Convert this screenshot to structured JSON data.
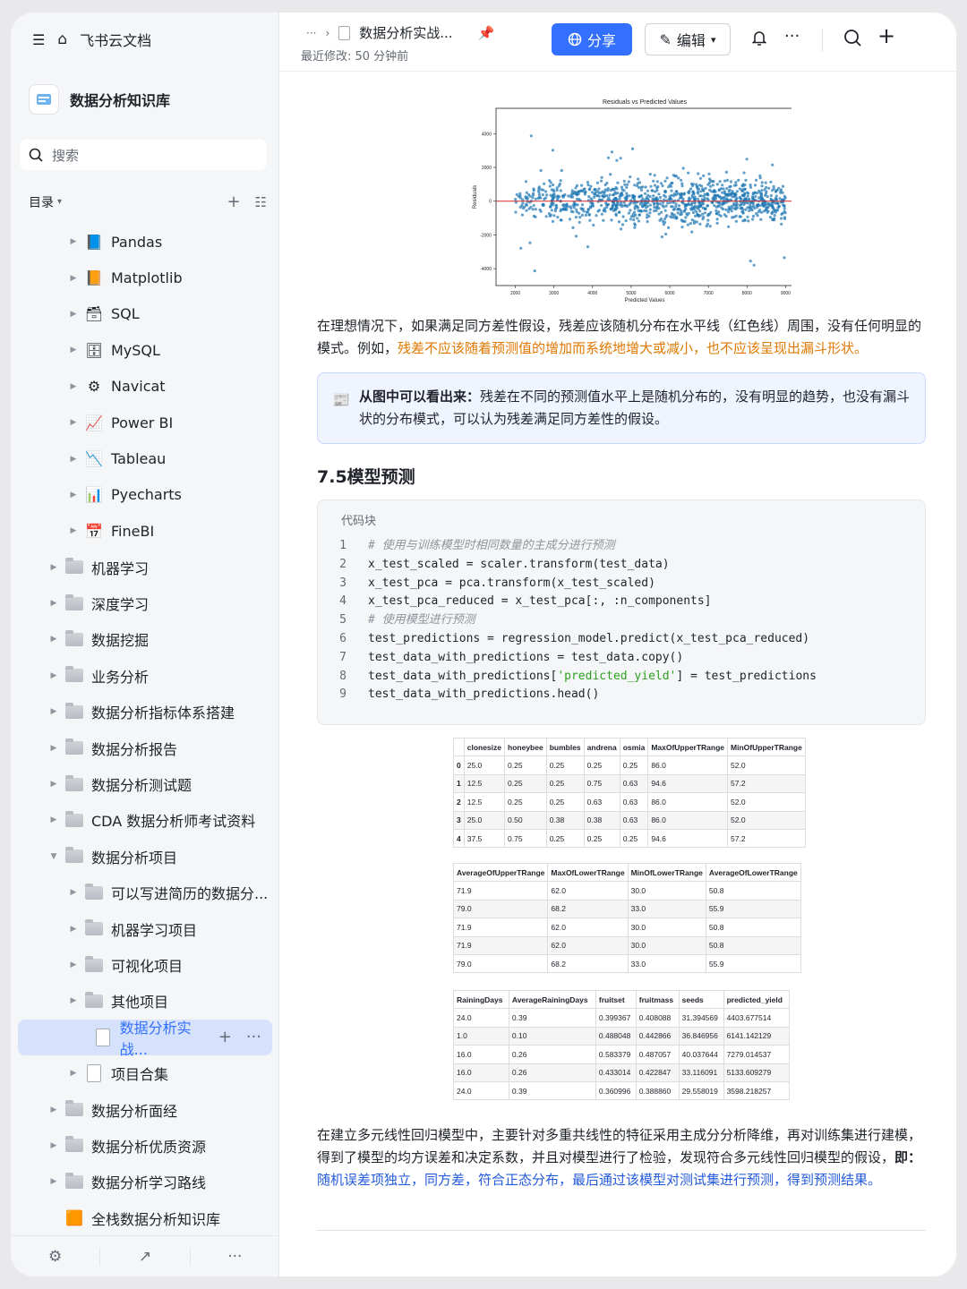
{
  "sidebar": {
    "app_title": "飞书云文档",
    "kb_title": "数据分析知识库",
    "search_placeholder": "搜索",
    "toc_label": "目录",
    "items": [
      {
        "label": "Pandas",
        "level": 2,
        "icon": "📘"
      },
      {
        "label": "Matplotlib",
        "level": 2,
        "icon": "📙"
      },
      {
        "label": "SQL",
        "level": 2,
        "icon": "🗃"
      },
      {
        "label": "MySQL",
        "level": 2,
        "icon": "🗄"
      },
      {
        "label": "Navicat",
        "level": 2,
        "icon": "⚙"
      },
      {
        "label": "Power BI",
        "level": 2,
        "icon": "📈"
      },
      {
        "label": "Tableau",
        "level": 2,
        "icon": "📉"
      },
      {
        "label": "Pyecharts",
        "level": 2,
        "icon": "📊"
      },
      {
        "label": "FineBI",
        "level": 2,
        "icon": "📅"
      },
      {
        "label": "机器学习",
        "level": 1,
        "icon": "folder"
      },
      {
        "label": "深度学习",
        "level": 1,
        "icon": "folder"
      },
      {
        "label": "数据挖掘",
        "level": 1,
        "icon": "folder"
      },
      {
        "label": "业务分析",
        "level": 1,
        "icon": "folder"
      },
      {
        "label": "数据分析指标体系搭建",
        "level": 1,
        "icon": "folder"
      },
      {
        "label": "数据分析报告",
        "level": 1,
        "icon": "folder"
      },
      {
        "label": "数据分析测试题",
        "level": 1,
        "icon": "folder"
      },
      {
        "label": "CDA 数据分析师考试资料",
        "level": 1,
        "icon": "folder"
      },
      {
        "label": "数据分析项目",
        "level": 1,
        "icon": "folder",
        "open": true
      },
      {
        "label": "可以写进简历的数据分...",
        "level": 2,
        "icon": "folder"
      },
      {
        "label": "机器学习项目",
        "level": 2,
        "icon": "folder"
      },
      {
        "label": "可视化项目",
        "level": 2,
        "icon": "folder"
      },
      {
        "label": "其他项目",
        "level": 2,
        "icon": "folder"
      },
      {
        "label": "数据分析实战...",
        "level": 3,
        "icon": "doc",
        "selected": true
      },
      {
        "label": "项目合集",
        "level": 2,
        "icon": "doc"
      },
      {
        "label": "数据分析面经",
        "level": 1,
        "icon": "folder"
      },
      {
        "label": "数据分析优质资源",
        "level": 1,
        "icon": "folder"
      },
      {
        "label": "数据分析学习路线",
        "level": 1,
        "icon": "folder"
      },
      {
        "label": "全栈数据分析知识库",
        "level": 1,
        "icon": "🟧",
        "leaf": true
      }
    ]
  },
  "header": {
    "breadcrumb_more": "···",
    "doc_title": "数据分析实战...",
    "modified": "最近修改: 50 分钟前",
    "share_label": "分享",
    "edit_label": "编辑"
  },
  "chart_data": {
    "type": "scatter",
    "title": "Residuals vs Predicted Values",
    "xlabel": "Predicted Values",
    "ylabel": "Residuals",
    "xlim": [
      1500,
      9200
    ],
    "ylim": [
      -5000,
      5500
    ],
    "xticks": [
      2000,
      3000,
      4000,
      5000,
      6000,
      7000,
      8000,
      9000
    ],
    "yticks": [
      -4000,
      -2000,
      0,
      2000,
      4000
    ],
    "reference_line": {
      "y": 0,
      "color": "#d62728"
    },
    "point_color": "#1f77b4",
    "cloud": {
      "x_range": [
        2000,
        9000
      ],
      "center_x": 6000,
      "spread_y": 600
    }
  },
  "content": {
    "para1_a": "在理想情况下，如果满足同方差性假设，残差应该随机分布在水平线（红色线）周围，没有任何明显的模式。例如，",
    "para1_b": "残差不应该随着预测值的增加而系统地增大或减小，也不应该呈现出漏斗形状。",
    "callout_bold": "从图中可以看出来：",
    "callout_text": "残差在不同的预测值水平上是随机分布的，没有明显的趋势，也没有漏斗状的分布模式，可以认为残差满足同方差性的假设。",
    "heading": "7.5模型预测",
    "code_title": "代码块",
    "code_lines": [
      {
        "n": "1",
        "t": "# 使用与训练模型时相同数量的主成分进行预测",
        "c": true
      },
      {
        "n": "2",
        "t": "x_test_scaled = scaler.transform(test_data)"
      },
      {
        "n": "3",
        "t": "x_test_pca = pca.transform(x_test_scaled)"
      },
      {
        "n": "4",
        "t": "x_test_pca_reduced = x_test_pca[:, :n_components]"
      },
      {
        "n": "5",
        "t": "# 使用模型进行预测",
        "c": true
      },
      {
        "n": "6",
        "t": "test_predictions = regression_model.predict(x_test_pca_reduced)"
      },
      {
        "n": "7",
        "t": "test_data_with_predictions = test_data.copy()"
      },
      {
        "n": "8",
        "t": "test_data_with_predictions[",
        "s": "'predicted_yield'",
        "after": "] = test_predictions"
      },
      {
        "n": "9",
        "t": "test_data_with_predictions.head()"
      }
    ],
    "table1": {
      "headers": [
        "",
        "clonesize",
        "honeybee",
        "bumbles",
        "andrena",
        "osmia",
        "MaxOfUpperTRange",
        "MinOfUpperTRange"
      ],
      "rows": [
        [
          "0",
          "25.0",
          "0.25",
          "0.25",
          "0.25",
          "0.25",
          "86.0",
          "52.0"
        ],
        [
          "1",
          "12.5",
          "0.25",
          "0.25",
          "0.75",
          "0.63",
          "94.6",
          "57.2"
        ],
        [
          "2",
          "12.5",
          "0.25",
          "0.25",
          "0.63",
          "0.63",
          "86.0",
          "52.0"
        ],
        [
          "3",
          "25.0",
          "0.50",
          "0.38",
          "0.38",
          "0.63",
          "86.0",
          "52.0"
        ],
        [
          "4",
          "37.5",
          "0.75",
          "0.25",
          "0.25",
          "0.25",
          "94.6",
          "57.2"
        ]
      ]
    },
    "table2": {
      "headers": [
        "AverageOfUpperTRange",
        "MaxOfLowerTRange",
        "MinOfLowerTRange",
        "AverageOfLowerTRange"
      ],
      "rows": [
        [
          "71.9",
          "62.0",
          "30.0",
          "50.8"
        ],
        [
          "79.0",
          "68.2",
          "33.0",
          "55.9"
        ],
        [
          "71.9",
          "62.0",
          "30.0",
          "50.8"
        ],
        [
          "71.9",
          "62.0",
          "30.0",
          "50.8"
        ],
        [
          "79.0",
          "68.2",
          "33.0",
          "55.9"
        ]
      ]
    },
    "table3": {
      "headers": [
        "RainingDays",
        "AverageRainingDays",
        "fruitset",
        "fruitmass",
        "seeds",
        "predicted_yield"
      ],
      "rows": [
        [
          "24.0",
          "0.39",
          "0.399367",
          "0.408088",
          "31.394569",
          "4403.677514"
        ],
        [
          "1.0",
          "0.10",
          "0.488048",
          "0.442866",
          "36.846956",
          "6141.142129"
        ],
        [
          "16.0",
          "0.26",
          "0.583379",
          "0.487057",
          "40.037644",
          "7279.014537"
        ],
        [
          "16.0",
          "0.26",
          "0.433014",
          "0.422847",
          "33.116091",
          "5133.609279"
        ],
        [
          "24.0",
          "0.39",
          "0.360996",
          "0.388860",
          "29.558019",
          "3598.218257"
        ]
      ]
    },
    "para2_a": "在建立多元线性回归模型中，主要针对多重共线性的特征采用主成分分析降维，再对训练集进行建模，得到了模型的均方误差和决定系数，并且对模型进行了检验，发现符合多元线性回归模型的假设，",
    "para2_bold": "即：",
    "para2_b": "随机误差项独立，同方差，符合正态分布，最后通过该模型对测试集进行预测，得到预测结果。"
  }
}
